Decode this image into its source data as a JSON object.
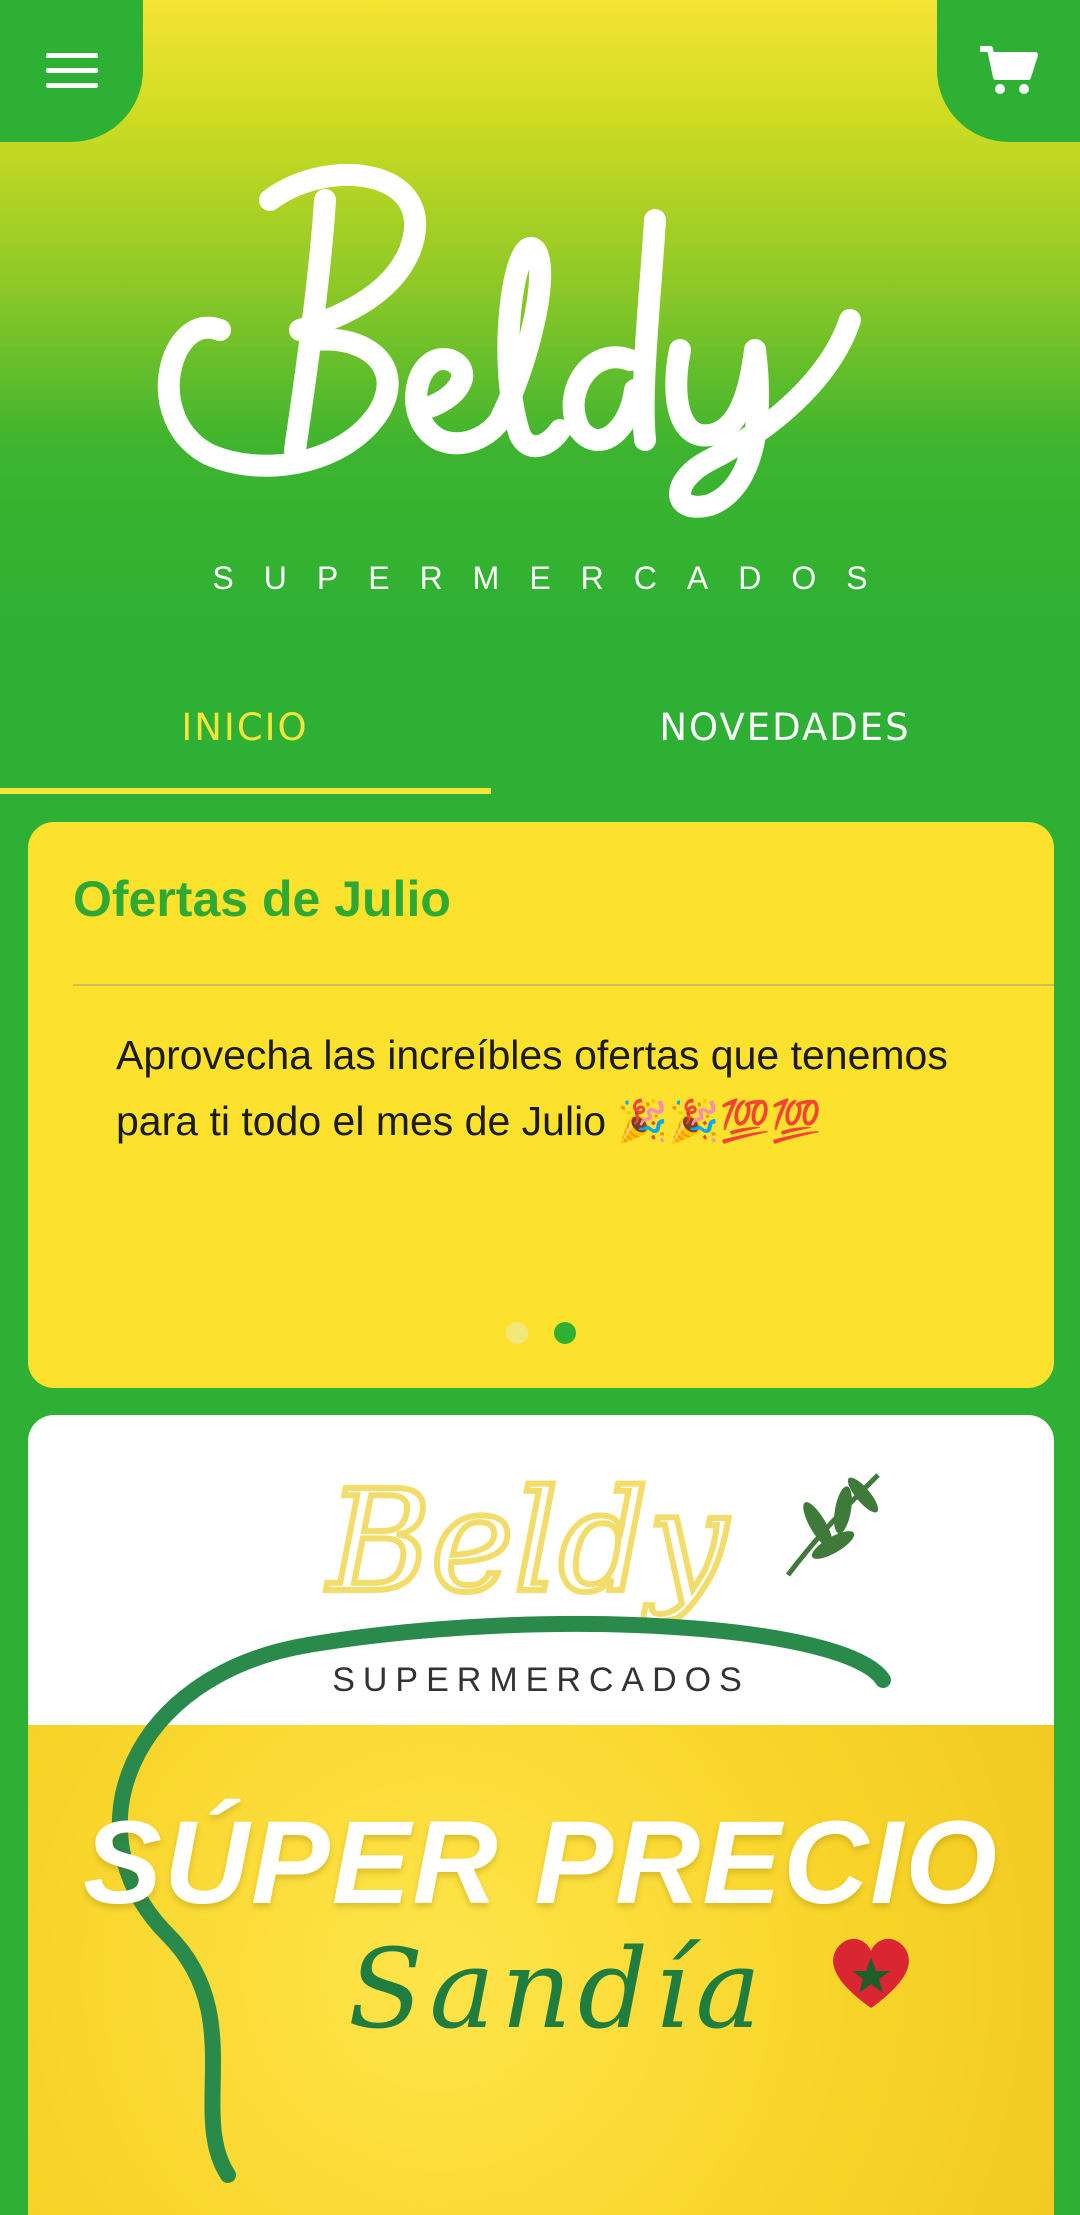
{
  "header": {
    "menu_icon": "hamburger-menu-icon",
    "cart_icon": "shopping-cart-icon",
    "logo_text": "Beldy",
    "tagline": "SUPERMERCADOS"
  },
  "tabs": [
    {
      "label": "INICIO",
      "active": true
    },
    {
      "label": "NOVEDADES",
      "active": false
    }
  ],
  "announcement": {
    "title": "Ofertas de Julio",
    "body": "Aprovecha las increíbles ofertas que tenemos para ti todo el mes de Julio 🎉🎉💯💯",
    "slides_total": 2,
    "active_slide": 2
  },
  "promo_image": {
    "brand": "Beldy",
    "subtitle": "SUPERMERCADOS",
    "headline": "SÚPER PRECIO",
    "product": "Sandía"
  },
  "colors": {
    "brand_green": "#2db034",
    "brand_yellow": "#fde22d",
    "tab_active": "#f3e63a"
  }
}
